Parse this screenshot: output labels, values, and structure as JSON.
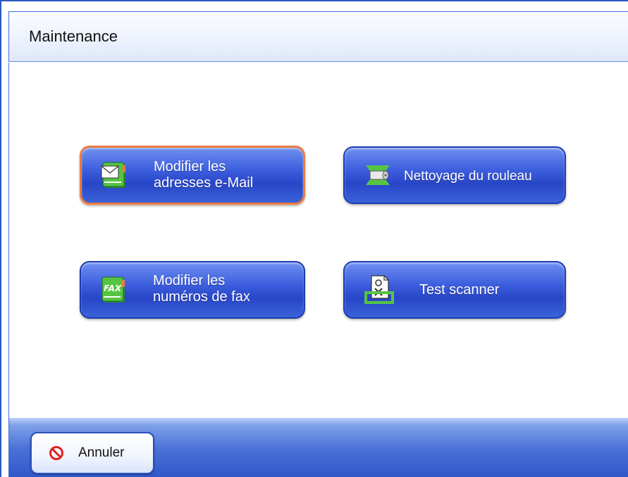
{
  "header": {
    "title": "Maintenance"
  },
  "buttons": {
    "email": {
      "line1": "Modifier les",
      "line2": "adresses e-Mail",
      "icon": "email-book-icon"
    },
    "roller": {
      "label": "Nettoyage du rouleau",
      "icon": "roller-icon"
    },
    "fax": {
      "line1": "Modifier les",
      "line2": "numéros de fax",
      "icon": "fax-book-icon",
      "icon_text": "FAX"
    },
    "test": {
      "label": "Test scanner",
      "icon": "test-scanner-icon"
    }
  },
  "footer": {
    "cancel_label": "Annuler",
    "cancel_icon": "prohibit-icon"
  },
  "colors": {
    "button_blue": "#3d5fde",
    "selected_border": "#f07a3c",
    "icon_green": "#4dbb3a",
    "cancel_red": "#e02020"
  }
}
